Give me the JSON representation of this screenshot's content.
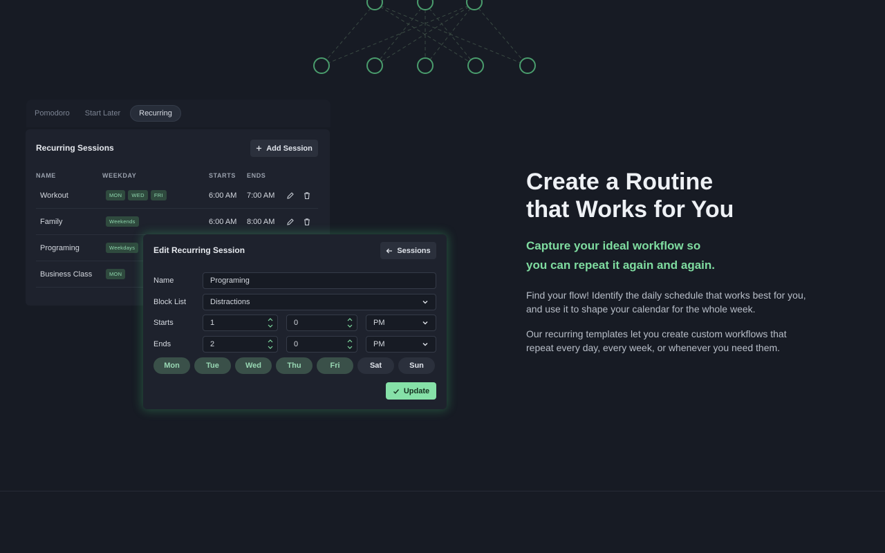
{
  "colors": {
    "accent": "#86e1a8",
    "background": "#171b24",
    "card": "#1e222d"
  },
  "tabs": [
    {
      "label": "Pomodoro",
      "active": false
    },
    {
      "label": "Start Later",
      "active": false
    },
    {
      "label": "Recurring",
      "active": true
    }
  ],
  "sessions_card": {
    "title": "Recurring Sessions",
    "add_label": "Add Session",
    "headers": {
      "name": "NAME",
      "weekday": "WEEKDAY",
      "starts": "STARTS",
      "ends": "ENDS"
    },
    "rows": [
      {
        "name": "Workout",
        "days": [
          "MON",
          "WED",
          "FRI"
        ],
        "starts": "6:00 AM",
        "ends": "7:00 AM"
      },
      {
        "name": "Family",
        "days": [
          "Weekends"
        ],
        "starts": "6:00 AM",
        "ends": "8:00 AM"
      },
      {
        "name": "Programing",
        "days": [
          "Weekdays"
        ]
      },
      {
        "name": "Business Class",
        "days": [
          "MON"
        ]
      }
    ]
  },
  "edit_modal": {
    "title": "Edit Recurring Session",
    "back_label": "Sessions",
    "labels": {
      "name": "Name",
      "block_list": "Block List",
      "starts": "Starts",
      "ends": "Ends"
    },
    "name_value": "Programing",
    "block_list_value": "Distractions",
    "starts": {
      "hour": "1",
      "minute": "0",
      "period": "PM"
    },
    "ends": {
      "hour": "2",
      "minute": "0",
      "period": "PM"
    },
    "days": [
      {
        "label": "Mon",
        "selected": true
      },
      {
        "label": "Tue",
        "selected": true
      },
      {
        "label": "Wed",
        "selected": true
      },
      {
        "label": "Thu",
        "selected": true
      },
      {
        "label": "Fri",
        "selected": true
      },
      {
        "label": "Sat",
        "selected": false
      },
      {
        "label": "Sun",
        "selected": false
      }
    ],
    "update_label": "Update"
  },
  "hero": {
    "title_line1": "Create a Routine",
    "title_line2": "that Works for You",
    "subtitle_line1": "Capture your ideal workflow so",
    "subtitle_line2": "you can repeat it again and again.",
    "para1": "Find your flow! Identify the daily schedule that works best for you, and use it to shape your calendar for the whole week.",
    "para2": "Our recurring templates let you create custom workflows that repeat every day, every week, or whenever you need them."
  }
}
